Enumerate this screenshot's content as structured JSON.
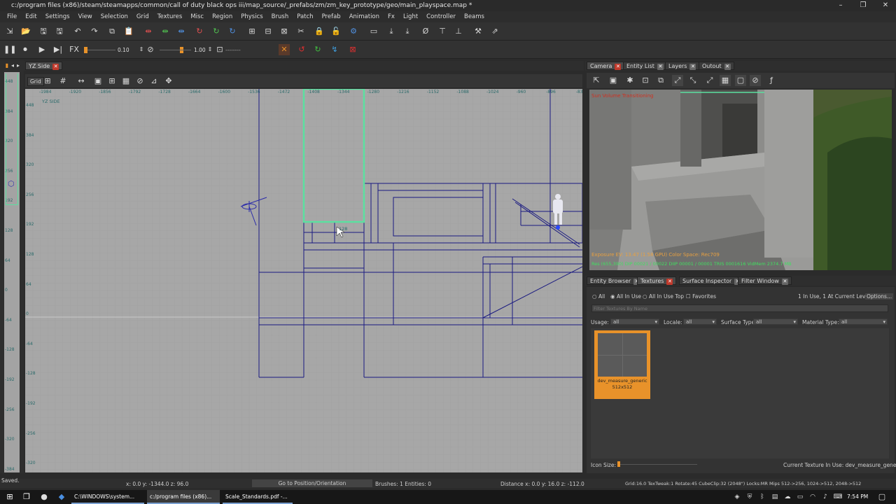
{
  "window": {
    "title": "c:/program files (x86)/steam/steamapps/common/call of duty black ops iii/map_source/_prefabs/zm/zm_key_prototype/geo/main_playspace.map *"
  },
  "menu": [
    "File",
    "Edit",
    "Settings",
    "View",
    "Selection",
    "Grid",
    "Textures",
    "Misc",
    "Region",
    "Physics",
    "Brush",
    "Patch",
    "Prefab",
    "Animation",
    "Fx",
    "Light",
    "Controller",
    "Beams"
  ],
  "toolbar2": {
    "speed_value": "0.10",
    "scale_value": "1.00",
    "fx_value": "--------"
  },
  "left_view": {
    "tab": "YZ Side",
    "view_label": "YZ SIDE",
    "grid_label": "Grid",
    "top_ruler": [
      "-1984",
      "-1920",
      "-1856",
      "-1792",
      "-1728",
      "-1664",
      "-1600",
      "-1536",
      "-1472",
      "-1408",
      "-1344",
      "-1280",
      "-1216",
      "-1152",
      "-1088",
      "-1024",
      "-960",
      "-896",
      "-832"
    ],
    "left_ruler": [
      "448",
      "384",
      "320",
      "256",
      "192",
      "128",
      "64",
      "0",
      "-64",
      "-128",
      "-192",
      "-256",
      "-320",
      "-384"
    ],
    "outer_ruler": [
      "448",
      "384",
      "320",
      "256",
      "192",
      "128",
      "64",
      "0",
      "-64",
      "-128",
      "-192",
      "-256",
      "-320",
      "-384"
    ],
    "brush_size_label": "128"
  },
  "right_panel": {
    "tabs": [
      "Camera",
      "Entity List",
      "Layers",
      "Outout"
    ],
    "camera_overlay": {
      "warning": "Sun Volume Transitioning",
      "exposure": "Exposure EV: 13.47 (1.58 GPU)  Color Space: Rec709",
      "stats": "Res (655,390)  DIP 00021 / 00022  DIIP 00001 / 00001  TRIS 0001616  VidMem 2374.7 MB"
    },
    "bottom_tabs": [
      "Entity Browser",
      "Textures",
      "Surface Inspector",
      "Filter Window"
    ],
    "filter_radios": [
      "All",
      "All In Use",
      "All In Use Top"
    ],
    "favorites_label": "Favorites",
    "in_use_info": "1 In Use, 1 At Current Level",
    "options_label": "Options...",
    "filter_placeholder": "Filter Textures By Name",
    "dropdowns": [
      {
        "label": "Usage:",
        "value": "all"
      },
      {
        "label": "Locale:",
        "value": "all"
      },
      {
        "label": "Surface Type:",
        "value": "all"
      },
      {
        "label": "Material Type:",
        "value": "all"
      }
    ],
    "texture": {
      "name": "dev_measure_generic",
      "size": "512x512"
    },
    "icon_size_label": "Icon Size:",
    "current_texture": "Current Texture In Use: dev_measure_generic"
  },
  "status": {
    "saved": "Saved.",
    "coords": "x: 0.0  y: -1344.0  z: 96.0",
    "goto_button": "Go to Position/Orientation",
    "brushes": "Brushes: 1 Entities: 0",
    "distance": "Distance x: 0.0  y: 16.0  z: -112.0",
    "grid_info": "Grid:16.0 TexTweak:1 Rotate:45 CubeClip:32 (2048\") Locks:MR  Mips 512->256, 1024->512, 2048->512"
  },
  "taskbar": {
    "items": [
      "C:\\WINDOWS\\system...",
      "c:/program files (x86)...",
      "Scale_Standards.pdf -..."
    ],
    "time": "7:54 PM"
  },
  "colors": {
    "accent_red": "#c0392b",
    "highlight_green": "#5be0a0",
    "brush_blue": "#1a1a80",
    "texture_orange": "#e8922a"
  }
}
